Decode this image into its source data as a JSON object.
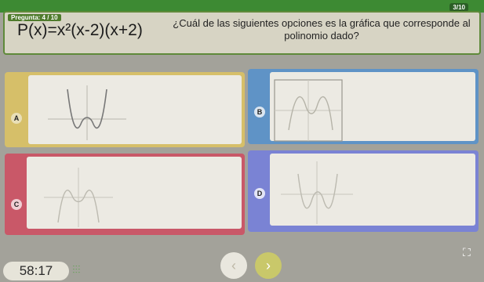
{
  "header": {
    "question_badge": "Pregunta: 4 / 10",
    "counter": "3/10",
    "polynomial": "P(x)=x²(x-2)(x+2)",
    "question": "¿Cuál de las siguientes opciones es la gráfica que corresponde al polinomio dado?"
  },
  "options": [
    {
      "letter": "A",
      "color": "#d6bf69"
    },
    {
      "letter": "B",
      "color": "#5f93c6"
    },
    {
      "letter": "C",
      "color": "#c95868"
    },
    {
      "letter": "D",
      "color": "#7a83d4"
    }
  ],
  "footer": {
    "timer": "58:17",
    "prev_icon": "chevron-left-icon",
    "next_icon": "chevron-right-icon",
    "fullscreen_icon": "fullscreen-icon"
  }
}
